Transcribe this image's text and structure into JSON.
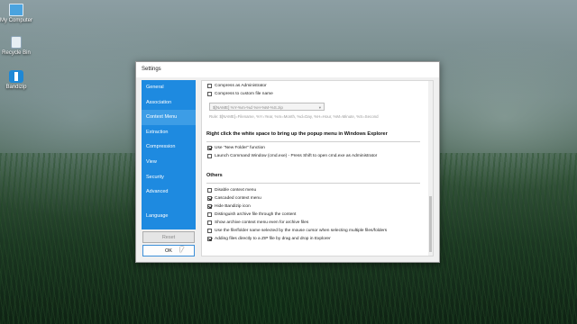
{
  "desktop": {
    "icons": [
      {
        "label": "My Computer",
        "icon": "computer-icon"
      },
      {
        "label": "Recycle Bin",
        "icon": "recycle-bin-icon"
      },
      {
        "label": "Bandizip",
        "icon": "bandizip-icon"
      }
    ]
  },
  "window": {
    "title": "Settings",
    "nav": [
      {
        "label": "General"
      },
      {
        "label": "Association"
      },
      {
        "label": "Context Menu",
        "active": true
      },
      {
        "label": "Extraction"
      },
      {
        "label": "Compression"
      },
      {
        "label": "View"
      },
      {
        "label": "Security"
      },
      {
        "label": "Advanced"
      }
    ],
    "language_label": "Language",
    "reset_label": "Reset",
    "ok_label": "OK",
    "accent_color": "#1e8ae0"
  },
  "content": {
    "top_checks": [
      {
        "label": "Compress as Administrator",
        "checked": false
      },
      {
        "label": "Compress to custom file name",
        "checked": false
      }
    ],
    "custom_name_value": "$[NAME] %Y-%m-%d %H-%M-%S.zip",
    "rule_hint": "Rule: $[NAME]=Filename, %Y=Year, %m=Month, %d=Day, %H=Hour, %M=Minute, %S=Second",
    "white_space_title": "Right click the white space to bring up the popup menu in Windows Explorer",
    "white_space_checks": [
      {
        "label": "Use \"New Folder\" function",
        "checked": true
      },
      {
        "label": "Launch Command Window (cmd.exe) - Press Shift to open cmd.exe as Administrator",
        "checked": false
      }
    ],
    "others_title": "Others",
    "others_checks": [
      {
        "label": "Disable context menu",
        "checked": false
      },
      {
        "label": "Cascaded context menu",
        "checked": true
      },
      {
        "label": "Hide Bandizip icon",
        "checked": true
      },
      {
        "label": "Distinguish archive file through the content",
        "checked": false
      },
      {
        "label": "Show archive context menu even for archive files",
        "checked": false
      },
      {
        "label": "Use the file/folder name selected by the mouse cursor when selecting multiple files/folders",
        "checked": false
      },
      {
        "label": "Adding files directly to a ZIP file by drag and drop in Explorer",
        "checked": true
      }
    ]
  }
}
